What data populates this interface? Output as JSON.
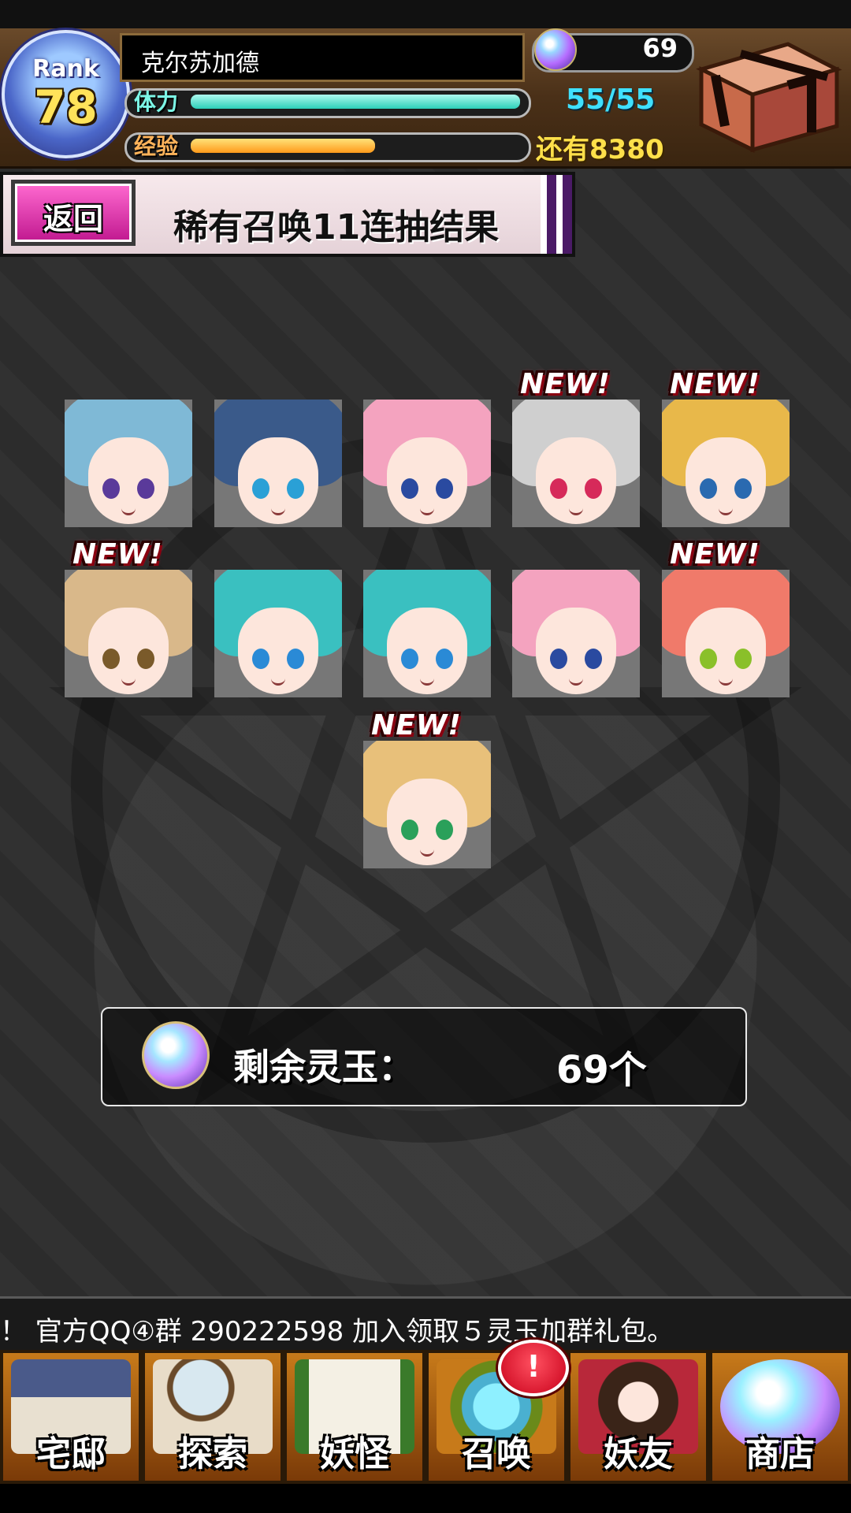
{
  "header": {
    "rank_label": "Rank",
    "rank_value": "78",
    "player_name": "克尔苏加德",
    "stamina_label": "体力",
    "exp_label": "经验",
    "stamina_value": "55/55",
    "stamina_fraction": 1.0,
    "exp_fraction": 0.56,
    "orb_count": "69",
    "remaining_exp": "还有8380"
  },
  "banner": {
    "back_label": "返回",
    "title": "稀有召唤11连抽结果"
  },
  "results": {
    "new_label": "NEW!",
    "cards": [
      {
        "name": "card-1",
        "new": false,
        "hair": "#7fb9d6",
        "eye": "#5a3a9a"
      },
      {
        "name": "card-2",
        "new": false,
        "hair": "#3a5a8a",
        "eye": "#2aa0d6"
      },
      {
        "name": "card-3",
        "new": false,
        "hair": "#f4a3bf",
        "eye": "#2a4aa0"
      },
      {
        "name": "card-4",
        "new": true,
        "hair": "#cfcfcf",
        "eye": "#d62a5a"
      },
      {
        "name": "card-5",
        "new": true,
        "hair": "#e8b84a",
        "eye": "#2a6ab0"
      },
      {
        "name": "card-6",
        "new": true,
        "hair": "#d9b88a",
        "eye": "#7a5a2a"
      },
      {
        "name": "card-7",
        "new": false,
        "hair": "#3ac0c0",
        "eye": "#2a8ad6"
      },
      {
        "name": "card-8",
        "new": false,
        "hair": "#3ac0c0",
        "eye": "#2a8ad6"
      },
      {
        "name": "card-9",
        "new": false,
        "hair": "#f4a3bf",
        "eye": "#2a4aa0"
      },
      {
        "name": "card-10",
        "new": true,
        "hair": "#f07a6a",
        "eye": "#8ac02a"
      },
      {
        "name": "card-11",
        "new": true,
        "hair": "#e8c07a",
        "eye": "#2aa05a"
      }
    ]
  },
  "remaining": {
    "label": "剩余灵玉：",
    "value": "69个"
  },
  "ticker": {
    "text": "！ 官方QQ④群 290222598  加入领取５灵玉加群礼包。"
  },
  "nav": {
    "items": [
      {
        "id": "home",
        "label": "宅邸",
        "icon": "house-icon"
      },
      {
        "id": "explore",
        "label": "探索",
        "icon": "magnifier-icon"
      },
      {
        "id": "yokai",
        "label": "妖怪",
        "icon": "scroll-icon"
      },
      {
        "id": "summon",
        "label": "召唤",
        "icon": "pentagram-icon"
      },
      {
        "id": "friends",
        "label": "妖友",
        "icon": "catgirl-icon"
      },
      {
        "id": "shop",
        "label": "商店",
        "icon": "orb-icon"
      }
    ],
    "summon_badge": "!"
  },
  "colors": {
    "stamina": "#2ccfb9",
    "exp": "#ff9a1a",
    "back_button": "#e0309f",
    "new_tag": "#c8001a"
  }
}
